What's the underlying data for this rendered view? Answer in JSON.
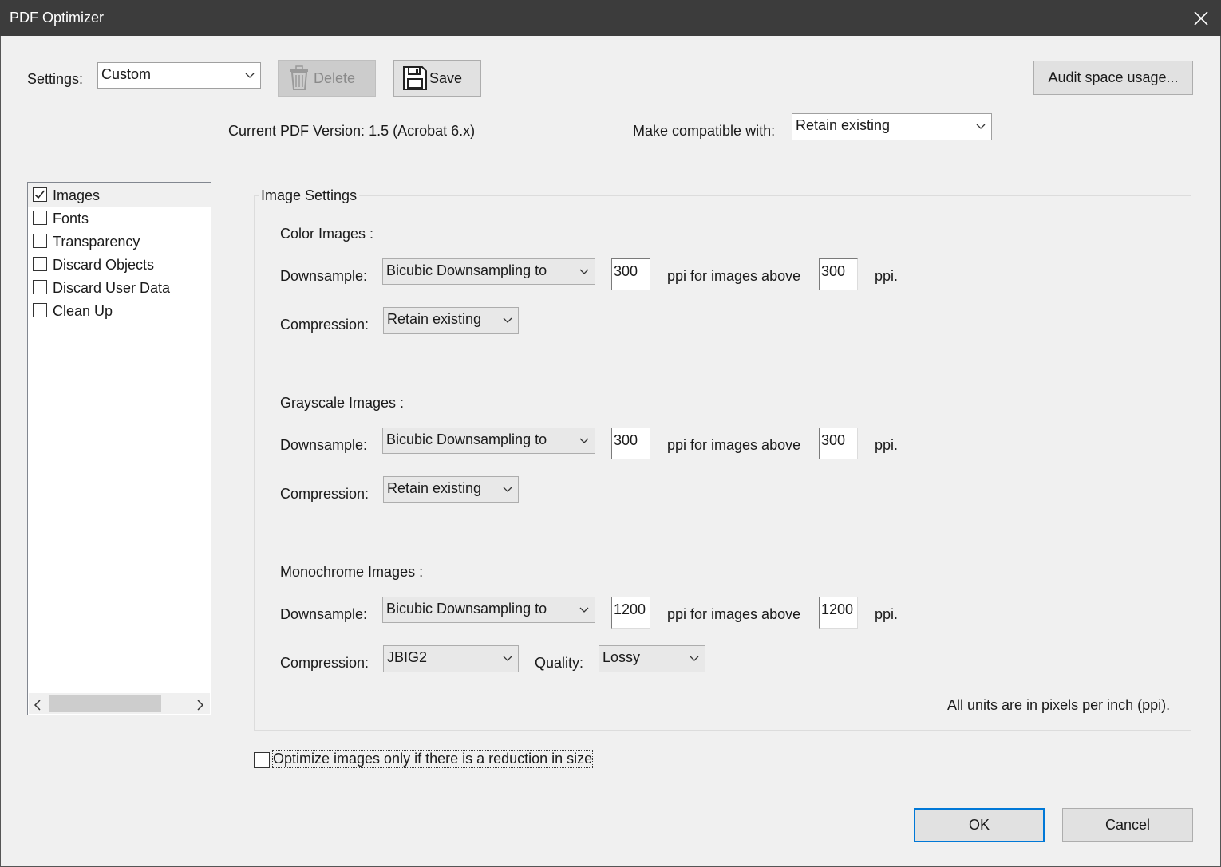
{
  "window": {
    "title": "PDF Optimizer"
  },
  "toolbar": {
    "settings_label": "Settings:",
    "settings_value": "Custom",
    "delete_label": "Delete",
    "save_label": "Save",
    "audit_label": "Audit space usage..."
  },
  "version": {
    "current": "Current PDF Version: 1.5 (Acrobat 6.x)",
    "compat_label": "Make compatible with:",
    "compat_value": "Retain existing"
  },
  "panels": [
    {
      "label": "Images",
      "checked": true
    },
    {
      "label": "Fonts",
      "checked": false
    },
    {
      "label": "Transparency",
      "checked": false
    },
    {
      "label": "Discard Objects",
      "checked": false
    },
    {
      "label": "Discard User Data",
      "checked": false
    },
    {
      "label": "Clean Up",
      "checked": false
    }
  ],
  "image_settings": {
    "title": "Image Settings",
    "downsample_label": "Downsample:",
    "compression_label": "Compression:",
    "ppi_above_label": "ppi for images above",
    "ppi_label": "ppi.",
    "quality_label": "Quality:",
    "color": {
      "heading": "Color Images :",
      "method": "Bicubic Downsampling to",
      "target_ppi": "300",
      "above_ppi": "300",
      "compression": "Retain existing"
    },
    "grayscale": {
      "heading": "Grayscale Images :",
      "method": "Bicubic Downsampling to",
      "target_ppi": "300",
      "above_ppi": "300",
      "compression": "Retain existing"
    },
    "monochrome": {
      "heading": "Monochrome Images :",
      "method": "Bicubic Downsampling to",
      "target_ppi": "1200",
      "above_ppi": "1200",
      "compression": "JBIG2",
      "quality": "Lossy"
    },
    "units_note": "All units are in pixels per inch (ppi)."
  },
  "optimize_only_if_smaller": {
    "label": "Optimize images only if there is a reduction in size",
    "checked": false
  },
  "footer": {
    "ok_label": "OK",
    "cancel_label": "Cancel"
  },
  "icons": {
    "close": "close-icon",
    "delete": "trash-icon",
    "save": "floppy-disk-icon",
    "dropdown": "chevron-down-icon",
    "check": "checkmark-icon"
  },
  "colors": {
    "titlebar": "#3c3c3c",
    "dialog_bg": "#f0f0f0",
    "focus_border": "#0078d7"
  }
}
